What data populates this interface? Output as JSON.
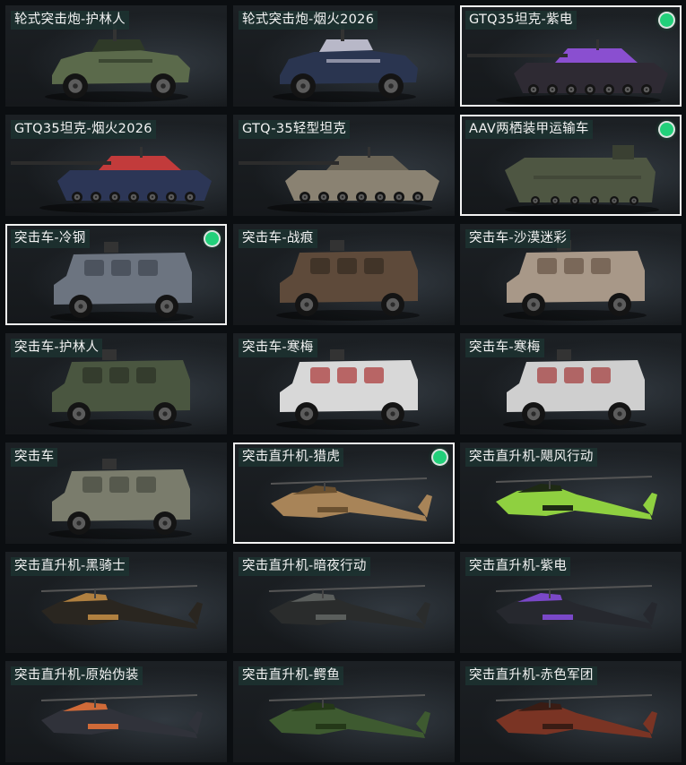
{
  "colors": {
    "background": "#0b0e11",
    "equipped_dot": "#22d07a",
    "label_bg": "#1c3432",
    "selected_border": "#f2f2f2"
  },
  "cards": [
    {
      "label": "轮式突击炮-护林人",
      "vehicle": "wheeled-assault-gun",
      "skin": "#5b6a4b",
      "accent": "#2f3a28",
      "selected": false,
      "equipped": false
    },
    {
      "label": "轮式突击炮-烟火2026",
      "vehicle": "wheeled-assault-gun",
      "skin": "#2a3550",
      "accent": "#b8b8c8",
      "selected": false,
      "equipped": false
    },
    {
      "label": "GTQ35坦克-紫电",
      "vehicle": "tank",
      "skin": "#2e2a33",
      "accent": "#8a4fd0",
      "selected": true,
      "equipped": true
    },
    {
      "label": "GTQ35坦克-烟火2026",
      "vehicle": "tank",
      "skin": "#2c3656",
      "accent": "#c23b3b",
      "selected": false,
      "equipped": false
    },
    {
      "label": "GTQ-35轻型坦克",
      "vehicle": "tank",
      "skin": "#8a8272",
      "accent": "#6a6456",
      "selected": false,
      "equipped": false
    },
    {
      "label": "AAV两栖装甲运输车",
      "vehicle": "amphibious",
      "skin": "#4e5642",
      "accent": "#3a4032",
      "selected": true,
      "equipped": true
    },
    {
      "label": "突击车-冷钢",
      "vehicle": "assault-car",
      "skin": "#6c7480",
      "accent": "#454b55",
      "selected": true,
      "equipped": true
    },
    {
      "label": "突击车-战痕",
      "vehicle": "assault-car",
      "skin": "#5e4a3a",
      "accent": "#3a2e24",
      "selected": false,
      "equipped": false
    },
    {
      "label": "突击车-沙漠迷彩",
      "vehicle": "assault-car",
      "skin": "#a89888",
      "accent": "#6e5c4e",
      "selected": false,
      "equipped": false
    },
    {
      "label": "突击车-护林人",
      "vehicle": "assault-car",
      "skin": "#4a5640",
      "accent": "#2e3628",
      "selected": false,
      "equipped": false
    },
    {
      "label": "突击车-寒梅",
      "vehicle": "assault-car",
      "skin": "#d8d8d8",
      "accent": "#b04848",
      "selected": false,
      "equipped": false
    },
    {
      "label": "突击车-寒梅",
      "vehicle": "assault-car",
      "skin": "#cfcfcf",
      "accent": "#a84a4a",
      "selected": false,
      "equipped": false
    },
    {
      "label": "突击车",
      "vehicle": "assault-car",
      "skin": "#7a7c6c",
      "accent": "#4e5046",
      "selected": false,
      "equipped": false
    },
    {
      "label": "突击直升机-猎虎",
      "vehicle": "helicopter",
      "skin": "#a88458",
      "accent": "#6a5030",
      "selected": true,
      "equipped": true
    },
    {
      "label": "突击直升机-飓风行动",
      "vehicle": "helicopter",
      "skin": "#8fd040",
      "accent": "#1e2a14",
      "selected": false,
      "equipped": false
    },
    {
      "label": "突击直升机-黑骑士",
      "vehicle": "helicopter",
      "skin": "#2a2620",
      "accent": "#b08040",
      "selected": false,
      "equipped": false
    },
    {
      "label": "突击直升机-暗夜行动",
      "vehicle": "helicopter",
      "skin": "#2a2c2c",
      "accent": "#5a5e5c",
      "selected": false,
      "equipped": false
    },
    {
      "label": "突击直升机-紫电",
      "vehicle": "helicopter",
      "skin": "#26282e",
      "accent": "#7a48c8",
      "selected": false,
      "equipped": false
    },
    {
      "label": "突击直升机-原始伪装",
      "vehicle": "helicopter",
      "skin": "#30323a",
      "accent": "#d06a38",
      "selected": false,
      "equipped": false
    },
    {
      "label": "突击直升机-鳄鱼",
      "vehicle": "helicopter",
      "skin": "#3e5a30",
      "accent": "#243818",
      "selected": false,
      "equipped": false
    },
    {
      "label": "突击直升机-赤色军团",
      "vehicle": "helicopter",
      "skin": "#7a3424",
      "accent": "#3a1c14",
      "selected": false,
      "equipped": false
    }
  ]
}
